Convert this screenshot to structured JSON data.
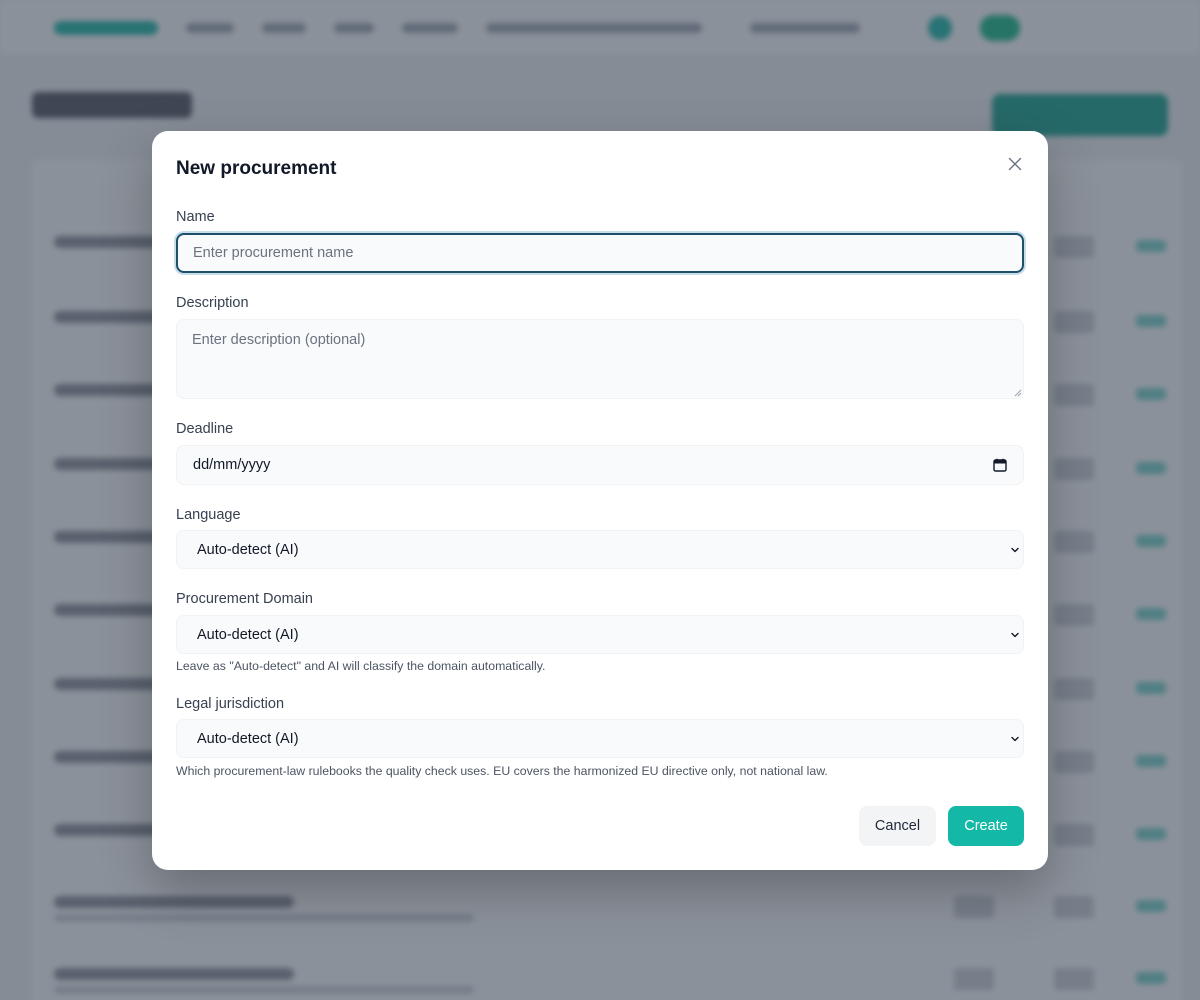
{
  "modal": {
    "title": "New procurement",
    "fields": {
      "name": {
        "label": "Name",
        "value": "",
        "placeholder": "Enter procurement name"
      },
      "description": {
        "label": "Description",
        "value": "",
        "placeholder": "Enter description (optional)"
      },
      "deadline": {
        "label": "Deadline",
        "value": "dd/mm/yyyy"
      },
      "language": {
        "label": "Language",
        "selected": "Auto-detect (AI)"
      },
      "domain": {
        "label": "Procurement Domain",
        "selected": "Auto-detect (AI)",
        "help": "Leave as \"Auto-detect\" and AI will classify the domain automatically."
      },
      "jurisdiction": {
        "label": "Legal jurisdiction",
        "selected": "Auto-detect (AI)",
        "help": "Which procurement-law rulebooks the quality check uses. EU covers the harmonized EU directive only, not national law."
      }
    },
    "buttons": {
      "cancel": "Cancel",
      "create": "Create"
    }
  },
  "icons": {
    "close": "close-icon",
    "calendar": "calendar-icon",
    "chevron": "chevron-down-icon"
  },
  "colors": {
    "accent": "#14b8a6",
    "focus_border": "#1e4f6b",
    "overlay": "rgba(55,65,81,0.58)"
  }
}
